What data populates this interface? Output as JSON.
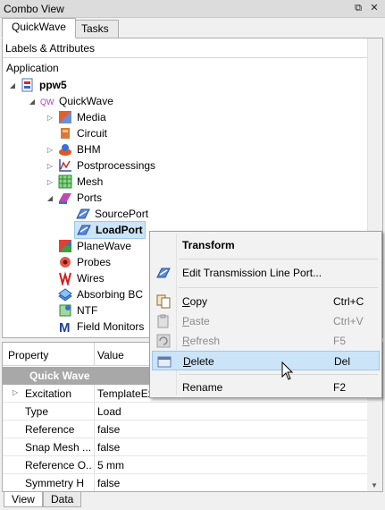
{
  "window": {
    "title": "Combo View"
  },
  "tabs": [
    {
      "label": "QuickWave"
    },
    {
      "label": "Tasks"
    }
  ],
  "tree_panel": {
    "header": "Labels & Attributes",
    "root_label": "Application",
    "items": [
      {
        "label": "ppw5",
        "bold": true
      },
      {
        "label": "QuickWave"
      },
      {
        "label": "Media"
      },
      {
        "label": "Circuit"
      },
      {
        "label": "BHM"
      },
      {
        "label": "Postprocessings"
      },
      {
        "label": "Mesh"
      },
      {
        "label": "Ports"
      },
      {
        "label": "SourcePort"
      },
      {
        "label": "LoadPort",
        "selected": true
      },
      {
        "label": "PlaneWave"
      },
      {
        "label": "Probes"
      },
      {
        "label": "Wires"
      },
      {
        "label": "Absorbing BC"
      },
      {
        "label": "NTF"
      },
      {
        "label": "Field Monitors"
      }
    ]
  },
  "property_grid": {
    "headers": {
      "property": "Property",
      "value": "Value"
    },
    "category": "Quick Wave",
    "rows": [
      {
        "name": "Excitation",
        "value": "TemplateEx"
      },
      {
        "name": "Type",
        "value": "Load"
      },
      {
        "name": "Reference",
        "value": "false"
      },
      {
        "name": "Snap Mesh ...",
        "value": "false"
      },
      {
        "name": "Reference O...",
        "value": "5 mm"
      },
      {
        "name": "Symmetry H",
        "value": "false"
      }
    ]
  },
  "bottom_tabs": [
    {
      "label": "View"
    },
    {
      "label": "Data"
    }
  ],
  "context_menu": {
    "title": "Transform",
    "items": [
      {
        "label": "Edit Transmission Line Port..."
      },
      {
        "label": "Copy",
        "shortcut": "Ctrl+C",
        "mnemonic": "C"
      },
      {
        "label": "Paste",
        "shortcut": "Ctrl+V",
        "mnemonic": "P",
        "disabled": true
      },
      {
        "label": "Refresh",
        "shortcut": "F5",
        "mnemonic": "R",
        "disabled": true
      },
      {
        "label": "Delete",
        "shortcut": "Del",
        "mnemonic": "D",
        "hovered": true
      },
      {
        "label": "Rename",
        "shortcut": "F2"
      }
    ]
  },
  "colors": {
    "selection": "#cce4f7",
    "selection_border": "#99c9ef",
    "category_bg": "#a8a8a8"
  }
}
